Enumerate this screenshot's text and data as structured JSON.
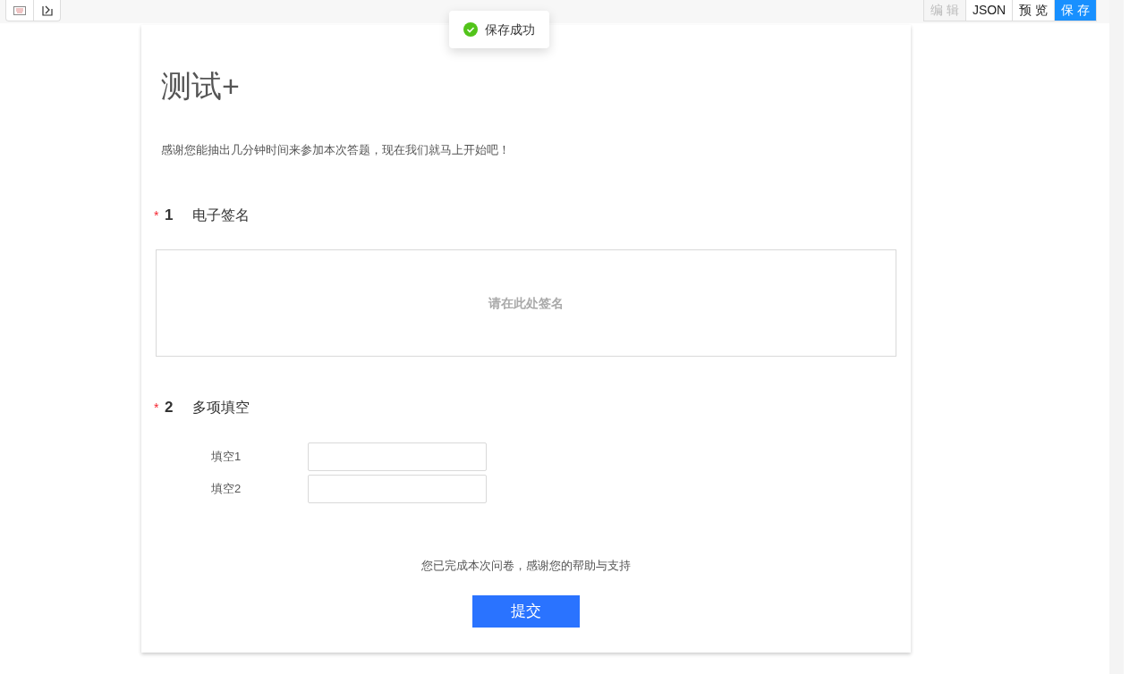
{
  "toolbar": {
    "actions": [
      {
        "label": "编 辑",
        "kind": "disabled"
      },
      {
        "label": "JSON",
        "kind": "default"
      },
      {
        "label": "预 览",
        "kind": "default"
      },
      {
        "label": "保 存",
        "kind": "primary"
      }
    ]
  },
  "toast": {
    "message": "保存成功",
    "kind": "success"
  },
  "survey": {
    "title": "测试+",
    "intro": "感谢您能抽出几分钟时间来参加本次答题，现在我们就马上开始吧！",
    "questions": [
      {
        "number": "1",
        "title": "电子签名",
        "required": true,
        "kind": "signature",
        "placeholder": "请在此处签名"
      },
      {
        "number": "2",
        "title": "多项填空",
        "required": true,
        "kind": "blanks",
        "blanks": [
          {
            "label": "填空1"
          },
          {
            "label": "填空2"
          }
        ]
      }
    ],
    "required_mark": "*",
    "closing": "您已完成本次问卷，感谢您的帮助与支持",
    "submit": "提交"
  }
}
